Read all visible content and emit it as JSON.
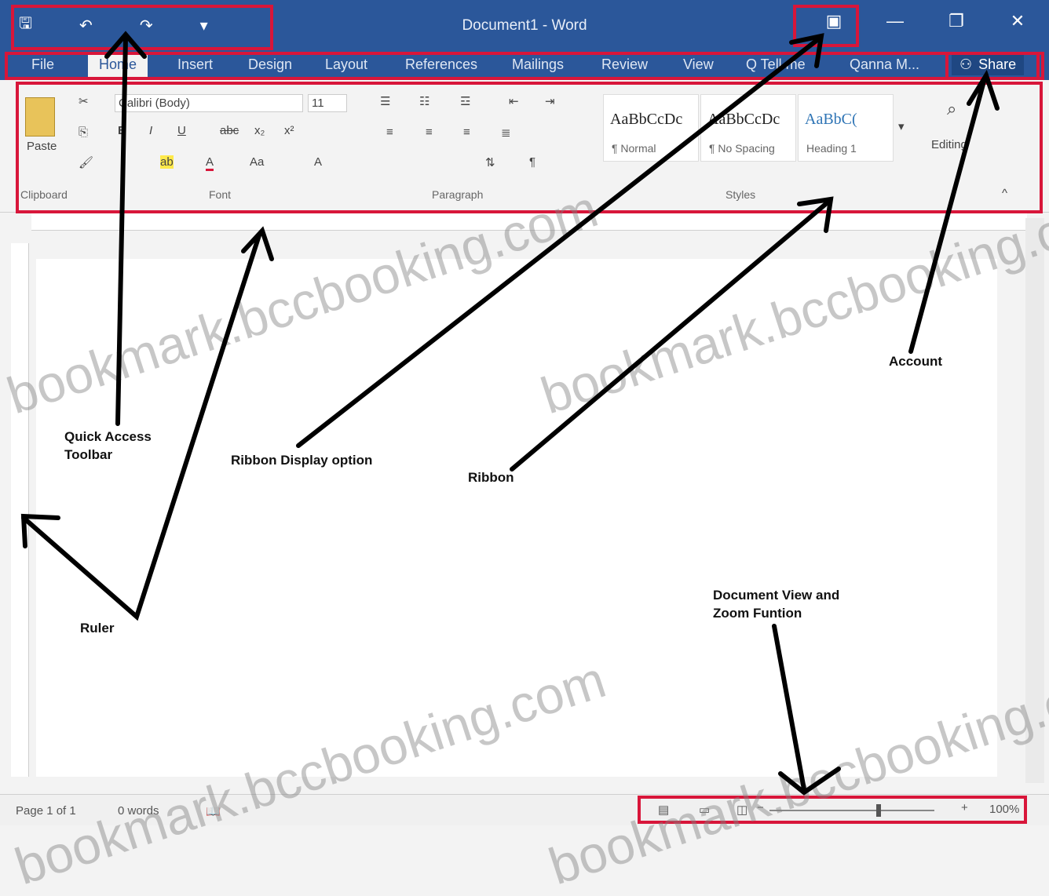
{
  "window": {
    "title": "Document1 - Word",
    "qat_icons": [
      "save-icon",
      "undo-icon",
      "redo-icon",
      "customize-qat-icon"
    ],
    "controls": {
      "ribbon_display": "ribbon-display-options-icon",
      "minimize": "—",
      "restore": "❐",
      "close": "✕"
    }
  },
  "tabs": [
    "File",
    "Home",
    "Insert",
    "Design",
    "Layout",
    "References",
    "Mailings",
    "Review",
    "View"
  ],
  "active_tab": "Home",
  "tell_me": "Q Tell me",
  "account_name": "Qanna M...",
  "share_label": "Share",
  "ribbon": {
    "clipboard": {
      "label": "Clipboard",
      "paste": "Paste"
    },
    "font": {
      "label": "Font",
      "name": "Calibri (Body)",
      "size": "11"
    },
    "paragraph": {
      "label": "Paragraph"
    },
    "styles": {
      "label": "Styles",
      "items": [
        {
          "sample": "AaBbCcDc",
          "name": "¶ Normal"
        },
        {
          "sample": "AaBbCcDc",
          "name": "¶ No Spacing"
        },
        {
          "sample": "AaBbC(",
          "name": "Heading 1"
        }
      ]
    },
    "editing": {
      "label": "Editing"
    }
  },
  "status": {
    "page": "Page 1 of 1",
    "words": "0 words",
    "zoom": "100%"
  },
  "callouts": {
    "quick_access_toolbar": "Quick Access\nToolbar",
    "ribbon_display_option": "Ribbon Display option",
    "ribbon": "Ribbon",
    "account": "Account",
    "ruler": "Ruler",
    "document_view_zoom": "Document View and\nZoom Funtion"
  },
  "watermark": "bookmark.bccbooking.com",
  "colors": {
    "word_blue": "#2b579a",
    "highlight_red": "#d8163a"
  }
}
